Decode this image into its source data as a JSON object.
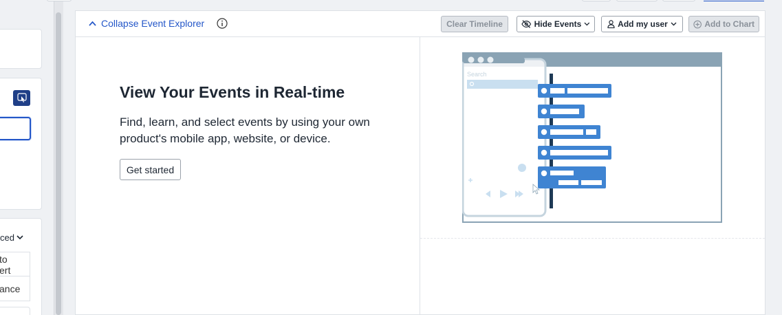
{
  "left_panel": {
    "dropdown_label": "ced",
    "cell1_text": "to\nert",
    "cell2_text": "ance"
  },
  "explorer": {
    "collapse_label": "Collapse Event Explorer",
    "buttons": {
      "clear_timeline": "Clear Timeline",
      "hide_events": "Hide Events",
      "add_my_user": "Add my user",
      "add_to_chart": "Add to Chart"
    },
    "title": "View Your Events in Real-time",
    "description": "Find, learn, and select events by using your own product's mobile app, website, or device.",
    "get_started": "Get started",
    "illustration": {
      "search_placeholder": "Search"
    }
  },
  "colors": {
    "accent": "#2356c8",
    "timeline_blue": "#3f84d2",
    "timeline_dark": "#1e3a56",
    "window_gray": "#8aa3b4"
  }
}
